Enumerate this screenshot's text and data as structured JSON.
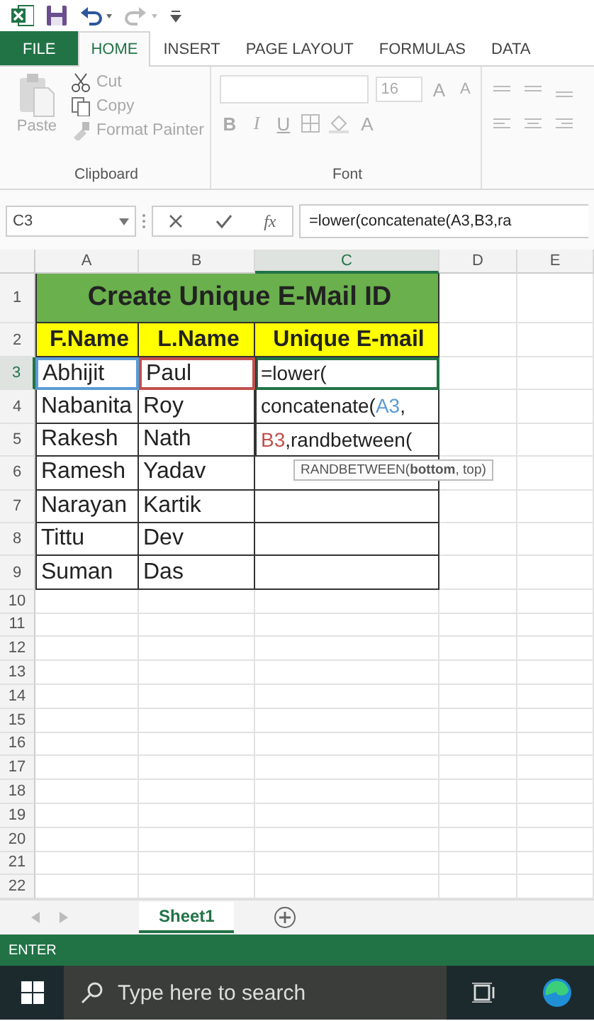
{
  "tabs": [
    {
      "label": "FILE",
      "kind": "file",
      "selected": false
    },
    {
      "label": "HOME",
      "kind": "tab",
      "selected": true
    },
    {
      "label": "INSERT",
      "kind": "tab",
      "selected": false
    },
    {
      "label": "PAGE LAYOUT",
      "kind": "tab",
      "selected": false
    },
    {
      "label": "FORMULAS",
      "kind": "tab",
      "selected": false
    },
    {
      "label": "DATA",
      "kind": "tab",
      "selected": false
    }
  ],
  "clipboard": {
    "paste": "Paste",
    "cut": "Cut",
    "copy": "Copy",
    "format_painter": "Format Painter",
    "label": "Clipboard",
    "disabled": true
  },
  "font": {
    "size": "16",
    "grow": "A",
    "shrink": "A",
    "bold": "B",
    "italic": "I",
    "underline": "U",
    "font_color": "A",
    "label": "Font",
    "disabled": true
  },
  "formula_bar": {
    "name_box": "C3",
    "function_label": "fx",
    "formula": "=lower(concatenate(A3,B3,ra"
  },
  "columns": [
    {
      "label": "A",
      "selected": false
    },
    {
      "label": "B",
      "selected": false
    },
    {
      "label": "C",
      "selected": true
    },
    {
      "label": "D",
      "selected": false
    },
    {
      "label": "E",
      "selected": false
    }
  ],
  "title": "Create Unique E-Mail ID",
  "headers": [
    "F.Name",
    "L.Name",
    "Unique E-mail"
  ],
  "records": [
    {
      "cells": [
        {
          "text": "Abhijit",
          "color": "#5b9bd5",
          "selected": false
        },
        {
          "text": "Paul",
          "color": "#c0504d",
          "selected": false
        },
        {
          "selected": true
        }
      ]
    },
    {
      "cells": [
        {
          "text": "Nabanita",
          "selected": false
        },
        {
          "text": "Roy",
          "selected": false
        },
        {
          "selected": false
        }
      ]
    },
    {
      "cells": [
        {
          "text": "Rakesh",
          "selected": false
        },
        {
          "text": "Nath",
          "selected": false
        },
        {
          "selected": false
        }
      ]
    },
    {
      "cells": [
        {
          "text": "Ramesh",
          "selected": false
        },
        {
          "text": "Yadav",
          "selected": false
        },
        {
          "selected": false
        }
      ]
    },
    {
      "cells": [
        {
          "text": "Narayan",
          "selected": false
        },
        {
          "text": "Kartik",
          "selected": false
        },
        {
          "selected": false
        }
      ]
    },
    {
      "cells": [
        {
          "text": "Tittu",
          "selected": false
        },
        {
          "text": "Dev",
          "selected": false
        },
        {
          "selected": false
        }
      ]
    },
    {
      "cells": [
        {
          "text": "Suman",
          "selected": false
        },
        {
          "text": "Das",
          "selected": false
        },
        {
          "selected": false
        }
      ]
    }
  ],
  "row_numbers": [
    {
      "label": "1",
      "selected": false
    },
    {
      "label": "2",
      "selected": false
    },
    {
      "label": "3",
      "selected": true
    },
    {
      "label": "4",
      "selected": false
    },
    {
      "label": "5",
      "selected": false
    },
    {
      "label": "6",
      "selected": false
    },
    {
      "label": "7",
      "selected": false
    },
    {
      "label": "8",
      "selected": false
    },
    {
      "label": "9",
      "selected": false
    },
    {
      "label": "10",
      "selected": false
    },
    {
      "label": "11",
      "selected": false
    },
    {
      "label": "12",
      "selected": false
    },
    {
      "label": "13",
      "selected": false
    },
    {
      "label": "14",
      "selected": false
    },
    {
      "label": "15",
      "selected": false
    },
    {
      "label": "16",
      "selected": false
    },
    {
      "label": "17",
      "selected": false
    },
    {
      "label": "18",
      "selected": false
    },
    {
      "label": "19",
      "selected": false
    },
    {
      "label": "20",
      "selected": false
    },
    {
      "label": "21",
      "selected": false
    },
    {
      "label": "22",
      "selected": false
    }
  ],
  "cell_edit": {
    "lines": [
      [
        {
          "text": "=lower("
        }
      ],
      [
        {
          "text": "concatenate("
        },
        {
          "text": "A3",
          "color": "#5b9bd5"
        },
        {
          "text": ","
        }
      ],
      [
        {
          "text": "B3",
          "color": "#c0504d"
        },
        {
          "text": ",randbetween("
        }
      ]
    ]
  },
  "tooltip": "RANDBETWEEN(**bottom**, top)",
  "sheets": [
    {
      "label": "Sheet1",
      "selected": true
    }
  ],
  "status": "ENTER",
  "taskbar": {
    "search_placeholder": "Type here to search"
  }
}
